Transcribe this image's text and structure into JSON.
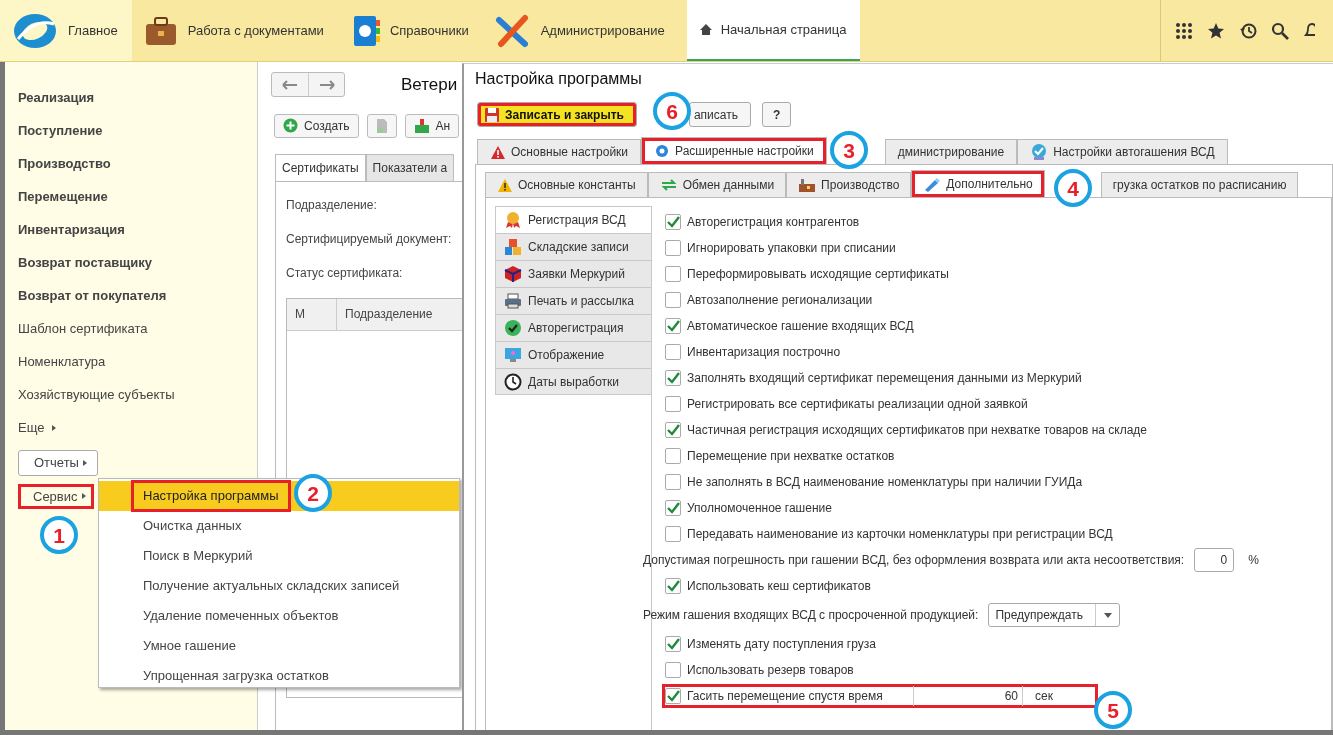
{
  "nav": {
    "sections": [
      {
        "label": "Главное",
        "selected": true
      },
      {
        "label": "Работа с документами",
        "selected": false
      },
      {
        "label": "Справочники",
        "selected": false
      },
      {
        "label": "Администрирование",
        "selected": false
      }
    ],
    "open_tab": {
      "label": "Начальная страница"
    }
  },
  "sidebar": {
    "items": [
      {
        "label": "Реализация",
        "bold": true
      },
      {
        "label": "Поступление",
        "bold": true
      },
      {
        "label": "Производство",
        "bold": true
      },
      {
        "label": "Перемещение",
        "bold": true
      },
      {
        "label": "Инвентаризация",
        "bold": true
      },
      {
        "label": "Возврат поставщику",
        "bold": true
      },
      {
        "label": "Возврат от покупателя",
        "bold": true
      },
      {
        "label": "Шаблон сертификата",
        "bold": false
      },
      {
        "label": "Номенклатура",
        "bold": false
      },
      {
        "label": "Хозяйствующие субъекты",
        "bold": false
      }
    ],
    "more": "Еще",
    "buttons": [
      {
        "label": "Отчеты",
        "highlighted": false
      },
      {
        "label": "Сервис",
        "highlighted": true
      }
    ]
  },
  "content": {
    "title": "Ветери",
    "create_button": "Создать",
    "third_button": "Ан",
    "tabs": [
      {
        "label": "Сертификаты",
        "selected": true
      },
      {
        "label": "Показатели а",
        "selected": false
      }
    ],
    "fields": [
      "Подразделение:",
      "Сертифицируемый документ:",
      "Статус сертификата:"
    ],
    "table": {
      "columns": [
        "М",
        "Подразделение"
      ]
    }
  },
  "service_menu": {
    "items": [
      {
        "label": "Настройка программы",
        "selected": true,
        "highlighted": true
      },
      {
        "label": "Очистка данных",
        "selected": false,
        "highlighted": false
      },
      {
        "label": "Поиск в Меркурий",
        "selected": false,
        "highlighted": false
      },
      {
        "label": "Получение актуальных складских записей",
        "selected": false,
        "highlighted": false
      },
      {
        "label": "Удаление помеченных объектов",
        "selected": false,
        "highlighted": false
      },
      {
        "label": "Умное гашение",
        "selected": false,
        "highlighted": false
      },
      {
        "label": "Упрощенная загрузка остатков",
        "selected": false,
        "highlighted": false
      }
    ]
  },
  "dialog": {
    "title": "Настройка программы",
    "buttons": [
      {
        "kind": "save-close",
        "label": "Записать и закрыть",
        "highlighted": true
      },
      {
        "kind": "save",
        "label": "аписать",
        "highlighted": false
      },
      {
        "kind": "help",
        "label": "?",
        "highlighted": false
      }
    ],
    "tabs": [
      {
        "label": "Основные настройки",
        "selected": false,
        "highlighted": false
      },
      {
        "label": "Расширенные настройки",
        "selected": true,
        "highlighted": true
      },
      {
        "label": "дминистрирование",
        "selected": false,
        "highlighted": false
      },
      {
        "label": "Настройки автогашения ВСД",
        "selected": false,
        "highlighted": false
      }
    ],
    "subtabs": [
      {
        "label": "Основные константы",
        "selected": false,
        "highlighted": false
      },
      {
        "label": "Обмен данными",
        "selected": false,
        "highlighted": false
      },
      {
        "label": "Производство",
        "selected": false,
        "highlighted": false
      },
      {
        "label": "Дополнительно",
        "selected": true,
        "highlighted": true
      },
      {
        "label": "грузка остатков по расписанию",
        "selected": false,
        "highlighted": false
      }
    ],
    "side_tabs": [
      {
        "label": "Регистрация ВСД",
        "selected": true
      },
      {
        "label": "Складские записи",
        "selected": false
      },
      {
        "label": "Заявки Меркурий",
        "selected": false
      },
      {
        "label": "Печать и рассылка",
        "selected": false
      },
      {
        "label": "Авторегистрация",
        "selected": false
      },
      {
        "label": "Отображение",
        "selected": false
      },
      {
        "label": "Даты выработки",
        "selected": false
      }
    ],
    "settings": [
      {
        "kind": "checkbox",
        "label": "Авторегистрация контрагентов",
        "checked": true,
        "highlighted": false
      },
      {
        "kind": "checkbox",
        "label": "Игнорировать упаковки при списании",
        "checked": false,
        "highlighted": false
      },
      {
        "kind": "checkbox",
        "label": "Переформировывать исходящие сертификаты",
        "checked": false,
        "highlighted": false
      },
      {
        "kind": "checkbox",
        "label": "Автозаполнение регионализации",
        "checked": false,
        "highlighted": false
      },
      {
        "kind": "checkbox",
        "label": "Автоматическое гашение входящих ВСД",
        "checked": true,
        "highlighted": false
      },
      {
        "kind": "checkbox",
        "label": "Инвентаризация построчно",
        "checked": false,
        "highlighted": false
      },
      {
        "kind": "checkbox",
        "label": "Заполнять входящий сертификат перемещения данными из Меркурий",
        "checked": true,
        "highlighted": false
      },
      {
        "kind": "checkbox",
        "label": "Регистрировать все сертификаты реализации одной заявкой",
        "checked": false,
        "highlighted": false
      },
      {
        "kind": "checkbox",
        "label": "Частичная регистрация исходящих сертификатов при нехватке товаров на складе",
        "checked": true,
        "highlighted": false
      },
      {
        "kind": "checkbox",
        "label": "Перемещение при нехватке остатков",
        "checked": false,
        "highlighted": false
      },
      {
        "kind": "checkbox",
        "label": "Не заполнять в ВСД наименование номенклатуры при наличии ГУИДа",
        "checked": false,
        "highlighted": false
      },
      {
        "kind": "checkbox",
        "label": "Уполномоченное гашение",
        "checked": true,
        "highlighted": false
      },
      {
        "kind": "checkbox",
        "label": "Передавать наименование из карточки номенклатуры при регистрации ВСД",
        "checked": false,
        "highlighted": false
      },
      {
        "kind": "number",
        "label": "Допустимая погрешность при гашении ВСД, без оформления возврата или акта несоответствия:",
        "value": "0",
        "unit": "%",
        "highlighted": false
      },
      {
        "kind": "checkbox",
        "label": "Использовать кеш сертификатов",
        "checked": true,
        "highlighted": false
      },
      {
        "kind": "select",
        "label": "Режим гашения входящих ВСД с просроченной продукцией:",
        "value": "Предупреждать",
        "highlighted": false
      },
      {
        "kind": "checkbox",
        "label": "Изменять дату поступления груза",
        "checked": true,
        "highlighted": false
      },
      {
        "kind": "checkbox",
        "label": "Использовать резерв товаров",
        "checked": false,
        "highlighted": false
      },
      {
        "kind": "timed-checkbox",
        "label": "Гасить перемещение спустя время",
        "checked": true,
        "value": "60",
        "unit": "сек",
        "highlighted": true
      }
    ]
  },
  "callouts": [
    "1",
    "2",
    "3",
    "4",
    "5",
    "6"
  ]
}
